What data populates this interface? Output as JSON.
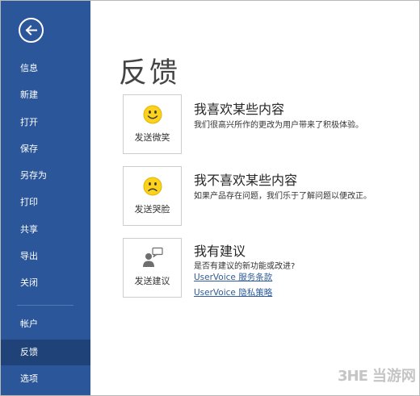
{
  "sidebar": {
    "items": [
      {
        "label": "信息"
      },
      {
        "label": "新建"
      },
      {
        "label": "打开"
      },
      {
        "label": "保存"
      },
      {
        "label": "另存为"
      },
      {
        "label": "打印"
      },
      {
        "label": "共享"
      },
      {
        "label": "导出"
      },
      {
        "label": "关闭"
      },
      {
        "label": "帐户"
      },
      {
        "label": "反馈",
        "active": true
      },
      {
        "label": "选项"
      }
    ]
  },
  "main": {
    "title": "反馈",
    "sections": [
      {
        "button_label": "发送微笑",
        "icon": "smiley-face-icon",
        "title": "我喜欢某些内容",
        "description": "我们很高兴所作的更改为用户带来了积极体验。"
      },
      {
        "button_label": "发送哭脸",
        "icon": "frown-face-icon",
        "title": "我不喜欢某些内容",
        "description": "如果产品存在问题，我们乐于了解问题以便改正。"
      },
      {
        "button_label": "发送建议",
        "icon": "person-speech-bubble-icon",
        "title": "我有建议",
        "description": "是否有建议的新功能或改进?",
        "links": [
          "UserVoice 服务条款",
          "UserVoice 隐私策略"
        ]
      }
    ]
  },
  "watermark": {
    "logo": "3HE",
    "text": "当游网"
  },
  "colors": {
    "sidebar_bg": "#2b579a",
    "sidebar_active": "#1f4278",
    "face_yellow": "#fcd21c",
    "link": "#2e5b9a"
  }
}
